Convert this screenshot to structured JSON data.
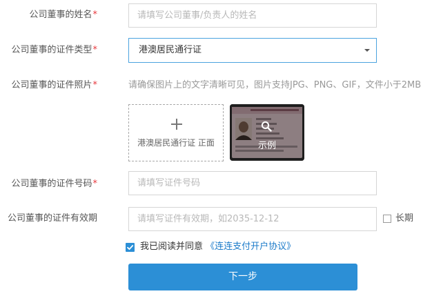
{
  "form": {
    "name": {
      "label": "公司董事的姓名",
      "required_mark": "*",
      "placeholder": "请填写公司董事/负责人的姓名"
    },
    "id_type": {
      "label": "公司董事的证件类型",
      "required_mark": "*",
      "selected": "港澳居民通行证"
    },
    "id_photo": {
      "label": "公司董事的证件照片",
      "required_mark": "*",
      "hint": "请确保图片上的文字清晰可见，图片支持JPG、PNG、GIF，文件小于2MB",
      "upload_label": "港澳居民通行证 正面",
      "example_label": "示例"
    },
    "id_number": {
      "label": "公司董事的证件号码",
      "required_mark": "*",
      "placeholder": "请填写证件号码"
    },
    "id_validity": {
      "label": "公司董事的证件有效期",
      "placeholder": "请填写证件有效期，如2035-12-12",
      "long_term_label": "长期"
    },
    "agreement": {
      "prefix": "我已阅读并同意",
      "link": "《连连支付开户协议》"
    },
    "next_button": "下一步"
  },
  "colors": {
    "accent": "#2c8fd6",
    "required": "#e8373c",
    "link": "#1a7ac9"
  }
}
